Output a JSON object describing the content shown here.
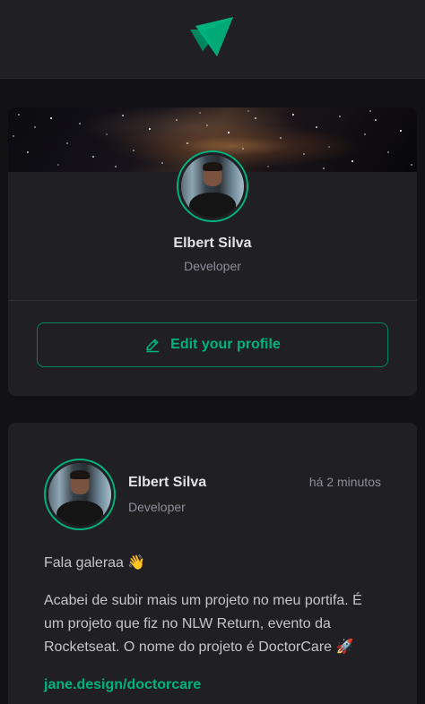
{
  "header": {
    "logo_icon": "ignite-triangle-logo"
  },
  "profile": {
    "name": "Elbert Silva",
    "role": "Developer",
    "edit_label": "Edit your profile",
    "edit_icon": "pencil-line-icon"
  },
  "post": {
    "author_name": "Elbert Silva",
    "author_role": "Developer",
    "time": "há 2 minutos",
    "paragraph1": "Fala galeraa 👋",
    "paragraph2": "Acabei de subir mais um projeto no meu portifa. É um projeto que fiz no NLW Return, evento da Rocketseat. O nome do projeto é DoctorCare 🚀",
    "link": "jane.design/doctorcare"
  },
  "colors": {
    "background": "#121214",
    "card": "#202024",
    "accent": "#00b37e",
    "accent_border": "#00875f",
    "text_primary": "#e1e1e6",
    "text_secondary": "#8d8d99"
  }
}
